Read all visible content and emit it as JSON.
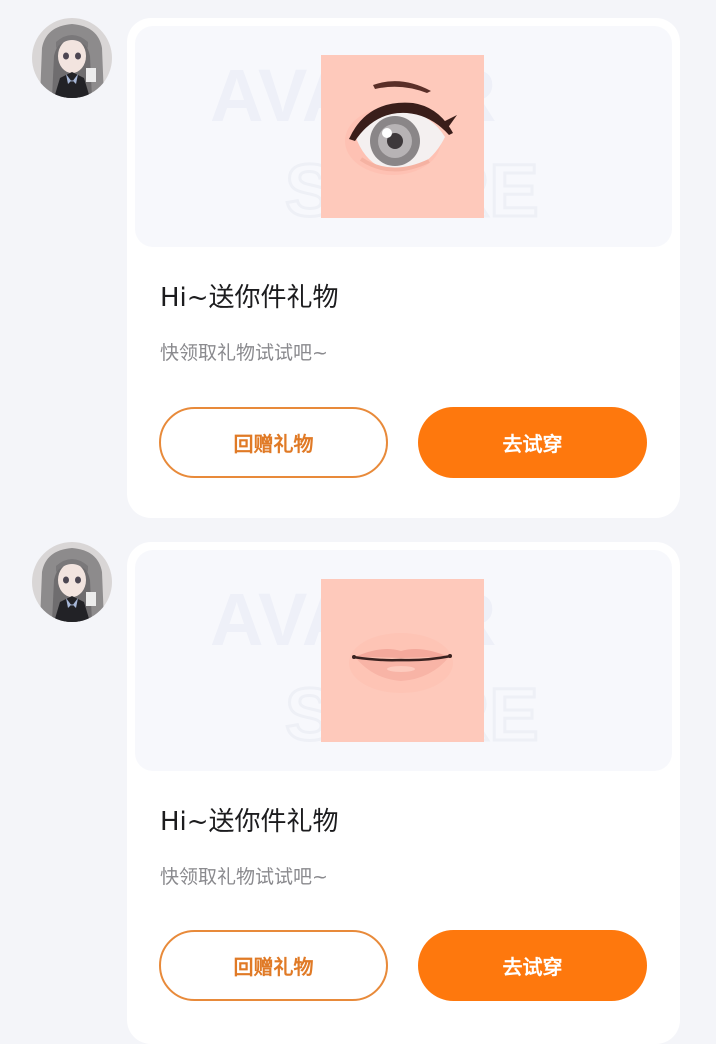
{
  "colors": {
    "page_background": "#f4f5f9",
    "card_background": "#ffffff",
    "preview_background": "#f7f8fc",
    "accent_orange": "#fe780d",
    "outline_orange": "#e88a3a",
    "skin_tone": "#fec9bb"
  },
  "messages": [
    {
      "avatar_icon": "anime-girl-avatar",
      "watermark_text_1": "AVATAR",
      "watermark_text_2": "STORE",
      "gift_item_icon": "eye-makeup-icon",
      "title": "Hi~送你件礼物",
      "subtitle": "快领取礼物试试吧~",
      "return_gift_label": "回赠礼物",
      "try_on_label": "去试穿"
    },
    {
      "avatar_icon": "anime-girl-avatar",
      "watermark_text_1": "AVATAR",
      "watermark_text_2": "STORE",
      "gift_item_icon": "lips-makeup-icon",
      "title": "Hi~送你件礼物",
      "subtitle": "快领取礼物试试吧~",
      "return_gift_label": "回赠礼物",
      "try_on_label": "去试穿"
    }
  ]
}
